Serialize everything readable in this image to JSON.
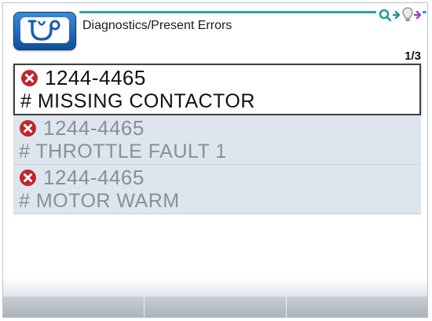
{
  "header": {
    "title": "Diagnostics/Present Errors",
    "app_icon": "stethoscope-icon",
    "status_icons": [
      "search-connect-icon",
      "arrow-icon",
      "lightbulb-icon",
      "arrow-icon"
    ]
  },
  "page_indicator": "1/3",
  "errors": [
    {
      "code": "1244-4465",
      "description": "# MISSING CONTACTOR",
      "icon": "error-icon",
      "selected": true
    },
    {
      "code": "1244-4465",
      "description": "# THROTTLE FAULT 1",
      "icon": "error-icon",
      "selected": false
    },
    {
      "code": "1244-4465",
      "description": "# MOTOR WARM",
      "icon": "error-icon",
      "selected": false
    }
  ],
  "softkeys": [
    "",
    "",
    ""
  ],
  "colors": {
    "accent": "#2c9fb7",
    "icon_blue": "#1a5fb4",
    "error_red": "#c0272d",
    "list_background": "#dde5ee"
  }
}
